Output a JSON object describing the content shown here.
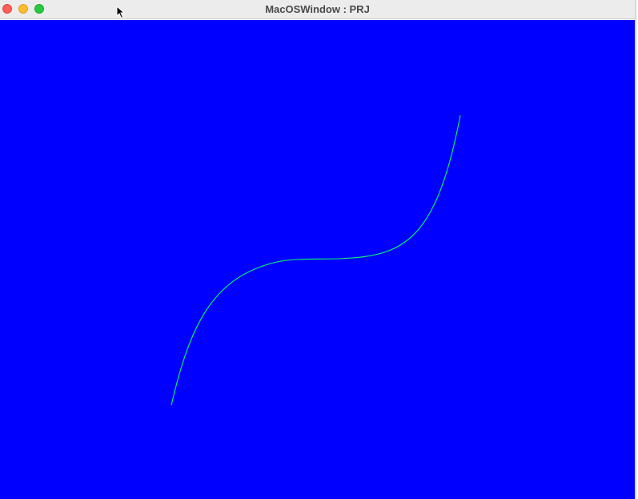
{
  "window": {
    "title": "MacOSWindow : PRJ"
  },
  "colors": {
    "canvas_background": "#0000ff",
    "curve_stroke": "#00ff66"
  },
  "icons": {
    "close": "close-button",
    "minimize": "minimize-button",
    "zoom": "zoom-button",
    "cursor": "mouse-pointer-icon"
  }
}
